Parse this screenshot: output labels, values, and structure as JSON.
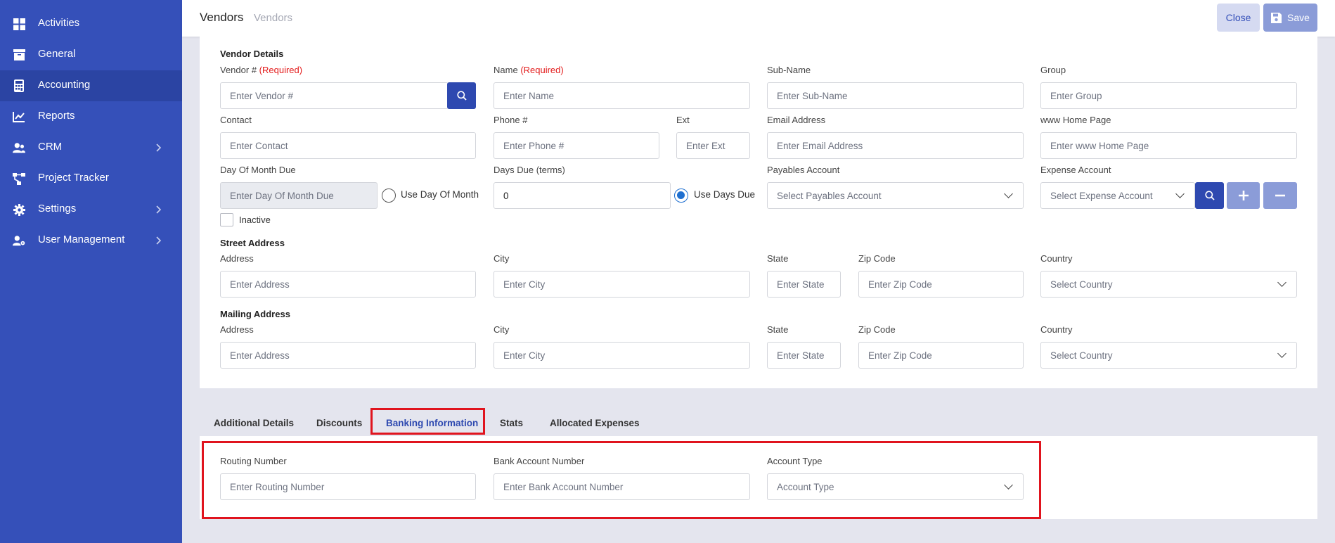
{
  "sidebar": {
    "items": [
      {
        "label": "Activities",
        "icon": "grid-icon",
        "has_arrow": false,
        "active": false
      },
      {
        "label": "General",
        "icon": "archive-icon",
        "has_arrow": false,
        "active": false
      },
      {
        "label": "Accounting",
        "icon": "calculator-icon",
        "has_arrow": false,
        "active": true
      },
      {
        "label": "Reports",
        "icon": "chart-line-icon",
        "has_arrow": false,
        "active": false
      },
      {
        "label": "CRM",
        "icon": "users-icon",
        "has_arrow": true,
        "active": false
      },
      {
        "label": "Project Tracker",
        "icon": "sitemap-icon",
        "has_arrow": false,
        "active": false
      },
      {
        "label": "Settings",
        "icon": "gear-icon",
        "has_arrow": true,
        "active": false
      },
      {
        "label": "User Management",
        "icon": "user-cog-icon",
        "has_arrow": true,
        "active": false
      }
    ]
  },
  "header": {
    "title": "Vendors",
    "breadcrumb": "Vendors",
    "close_label": "Close",
    "save_label": "Save"
  },
  "vendor_details": {
    "section_title": "Vendor Details",
    "vendor_no": {
      "label": "Vendor #",
      "required": "(Required)",
      "placeholder": "Enter Vendor #"
    },
    "name": {
      "label": "Name",
      "required": "(Required)",
      "placeholder": "Enter Name"
    },
    "sub_name": {
      "label": "Sub-Name",
      "placeholder": "Enter Sub-Name"
    },
    "group": {
      "label": "Group",
      "placeholder": "Enter Group"
    },
    "contact": {
      "label": "Contact",
      "placeholder": "Enter Contact"
    },
    "phone": {
      "label": "Phone #",
      "placeholder": "Enter Phone #"
    },
    "ext": {
      "label": "Ext",
      "placeholder": "Enter Ext"
    },
    "email": {
      "label": "Email Address",
      "placeholder": "Enter Email Address"
    },
    "home_page": {
      "label": "www Home Page",
      "placeholder": "Enter www Home Page"
    },
    "day_of_month_due": {
      "label": "Day Of Month Due",
      "placeholder": "Enter Day Of Month Due",
      "radio_label": "Use Day Of Month",
      "selected": false
    },
    "days_due": {
      "label": "Days Due (terms)",
      "value": "0",
      "radio_label": "Use Days Due",
      "selected": true
    },
    "payables_account": {
      "label": "Payables Account",
      "placeholder": "Select Payables Account"
    },
    "expense_account": {
      "label": "Expense Account",
      "placeholder": "Select Expense Account"
    },
    "inactive": {
      "label": "Inactive",
      "checked": false
    }
  },
  "street_address": {
    "section_title": "Street Address",
    "address": {
      "label": "Address",
      "placeholder": "Enter Address"
    },
    "city": {
      "label": "City",
      "placeholder": "Enter City"
    },
    "state": {
      "label": "State",
      "placeholder": "Enter State"
    },
    "zip": {
      "label": "Zip Code",
      "placeholder": "Enter Zip Code"
    },
    "country": {
      "label": "Country",
      "placeholder": "Select Country"
    }
  },
  "mailing_address": {
    "section_title": "Mailing Address",
    "address": {
      "label": "Address",
      "placeholder": "Enter Address"
    },
    "city": {
      "label": "City",
      "placeholder": "Enter City"
    },
    "state": {
      "label": "State",
      "placeholder": "Enter State"
    },
    "zip": {
      "label": "Zip Code",
      "placeholder": "Enter Zip Code"
    },
    "country": {
      "label": "Country",
      "placeholder": "Select Country"
    }
  },
  "tabs": [
    {
      "label": "Additional Details",
      "active": false
    },
    {
      "label": "Discounts",
      "active": false
    },
    {
      "label": "Banking Information",
      "active": true
    },
    {
      "label": "Stats",
      "active": false
    },
    {
      "label": "Allocated Expenses",
      "active": false
    }
  ],
  "banking": {
    "routing": {
      "label": "Routing Number",
      "placeholder": "Enter Routing Number"
    },
    "account_number": {
      "label": "Bank Account Number",
      "placeholder": "Enter Bank Account Number"
    },
    "account_type": {
      "label": "Account Type",
      "placeholder": "Account Type"
    }
  },
  "colors": {
    "sidebar_bg": "#3550b9",
    "sidebar_active": "#2b44a3",
    "primary": "#2e49b0",
    "required": "#e31b1b",
    "highlight": "#e0141e"
  }
}
